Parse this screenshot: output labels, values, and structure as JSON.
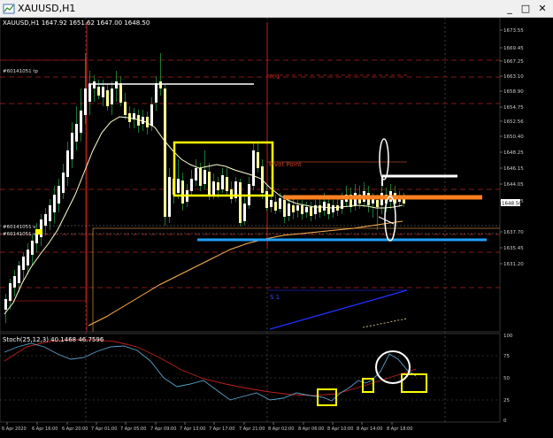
{
  "window": {
    "title": "XAUUSD,H1",
    "minimize": "_",
    "maximize": "□",
    "close": "✕"
  },
  "header": {
    "ohlc": "XAUUSD,H1  1647.92 1651.62 1647.00 1648.50"
  },
  "subwindow": {
    "label": "Stoch(25,12,3) 40.1468 46.7596"
  },
  "order_labels": {
    "top": "#60141051 tp",
    "line1": "#60141051 s",
    "line2": "#60141051 s"
  },
  "chart_labels": {
    "r1": "R 1",
    "pivot": "Pivot Point",
    "s1": "S 1"
  },
  "price_axis": {
    "labels": [
      "1673.55",
      "1669.45",
      "1667.25",
      "1663.10",
      "1658.90",
      "1654.75",
      "1652.56",
      "1650.40",
      "1648.25",
      "1646.15",
      "1644.05",
      "1641.95",
      "1637.70",
      "1635.45",
      "1631.20"
    ],
    "current_price": "1648.50"
  },
  "osc_axis": {
    "labels": [
      "100",
      "75",
      "50",
      "25",
      "0"
    ]
  },
  "time_axis": {
    "labels": [
      "6 Apr 2020",
      "6 Apr 16:00",
      "6 Apr 20:00",
      "7 Apr 01:00",
      "7 Apr 05:00",
      "7 Apr 09:00",
      "7 Apr 13:00",
      "7 Apr 17:00",
      "7 Apr 21:00",
      "8 Apr 02:00",
      "8 Apr 06:00",
      "8 Apr 10:00",
      "8 Apr 14:00",
      "8 Apr 18:00"
    ]
  },
  "colors": {
    "bull": "#ffffff",
    "bear": "#ffff99",
    "ma_fast": "#ffffcc",
    "ma_slow": "#ffb050",
    "stoch_main": "#5aa0c8",
    "stoch_signal": "#c02020",
    "highlight": "#ffff00",
    "support": "#1e90ff",
    "orange_line": "#ff8000",
    "grid": "#555555"
  }
}
